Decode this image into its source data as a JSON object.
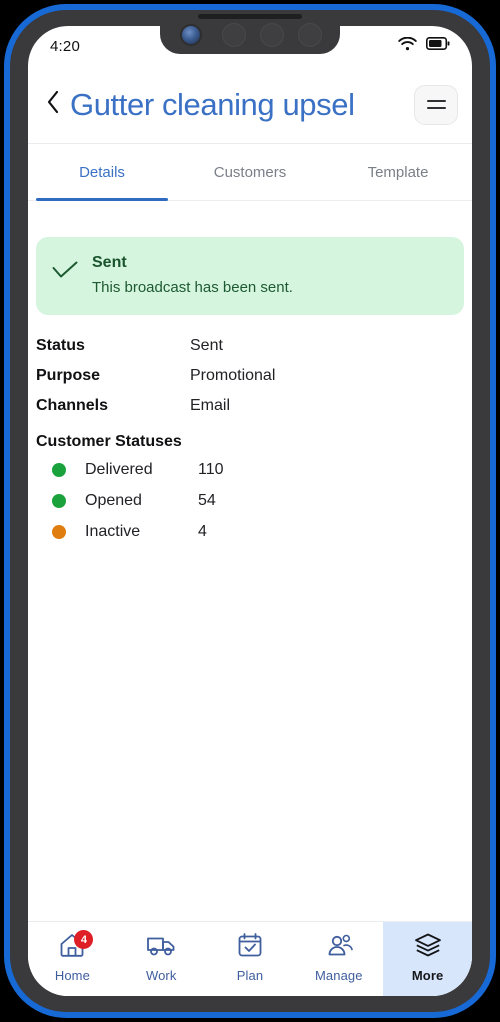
{
  "status_bar": {
    "time": "4:20",
    "wifi_icon": "wifi-icon",
    "battery_icon": "battery-icon"
  },
  "header": {
    "back_icon": "chevron-left-icon",
    "title": "Gutter cleaning upsel",
    "menu_icon": "hamburger-menu-icon"
  },
  "tabs": [
    {
      "label": "Details",
      "active": true
    },
    {
      "label": "Customers",
      "active": false
    },
    {
      "label": "Template",
      "active": false
    }
  ],
  "banner": {
    "icon": "check-icon",
    "title": "Sent",
    "text": "This broadcast has been sent.",
    "bg_color": "#d6f5de",
    "text_color": "#1d5a31"
  },
  "details": [
    {
      "key": "Status",
      "value": "Sent"
    },
    {
      "key": "Purpose",
      "value": "Promotional"
    },
    {
      "key": "Channels",
      "value": "Email"
    }
  ],
  "customer_statuses": {
    "title": "Customer Statuses",
    "rows": [
      {
        "label": "Delivered",
        "value": "110",
        "color": "#1aa33c"
      },
      {
        "label": "Opened",
        "value": "54",
        "color": "#1aa33c"
      },
      {
        "label": "Inactive",
        "value": "4",
        "color": "#e07d10"
      }
    ]
  },
  "bottom_nav": [
    {
      "label": "Home",
      "icon": "home-icon",
      "badge": "4",
      "active": false
    },
    {
      "label": "Work",
      "icon": "truck-icon",
      "badge": "",
      "active": false
    },
    {
      "label": "Plan",
      "icon": "calendar-check-icon",
      "badge": "",
      "active": false
    },
    {
      "label": "Manage",
      "icon": "users-icon",
      "badge": "",
      "active": false
    },
    {
      "label": "More",
      "icon": "layers-icon",
      "badge": "",
      "active": true
    }
  ],
  "colors": {
    "accent_blue": "#3a71c4",
    "tab_underline": "#2f6bbf",
    "badge_red": "#de1f26",
    "active_nav_bg": "#d8e6fb"
  }
}
